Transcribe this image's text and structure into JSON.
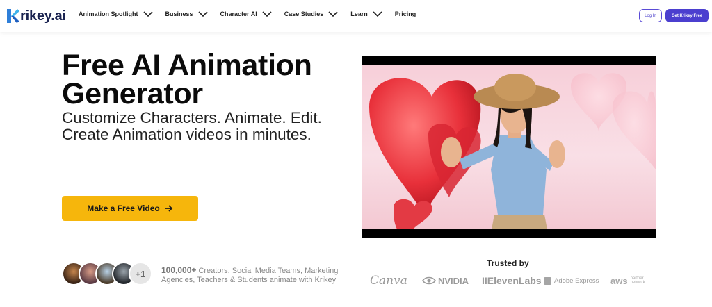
{
  "brand": {
    "logo_text": "rikey.ai",
    "logo_letter": "K"
  },
  "nav": {
    "items": [
      {
        "label": "Animation Spotlight",
        "has_dropdown": true
      },
      {
        "label": "Business",
        "has_dropdown": true
      },
      {
        "label": "Character AI",
        "has_dropdown": true
      },
      {
        "label": "Case Studies",
        "has_dropdown": true
      },
      {
        "label": "Learn",
        "has_dropdown": true
      },
      {
        "label": "Pricing",
        "has_dropdown": false
      }
    ],
    "login_label": "Log In",
    "get_free_label": "Get Krikey Free"
  },
  "hero": {
    "title_line1": "Free AI Animation",
    "title_line2": "Generator",
    "subtitle_line1": "Customize Characters. Animate. Edit.",
    "subtitle_line2": "Create Animation videos in minutes.",
    "cta_label": "Make a Free Video"
  },
  "social_proof": {
    "count": "100,000+",
    "text": " Creators, Social Media Teams, Marketing Agencies, Teachers & Students animate with Krikey",
    "more_avatars": "+1"
  },
  "trusted": {
    "label": "Trusted by",
    "brands": [
      "Canva",
      "NVIDIA",
      "IIElevenLabs",
      "Adobe Express",
      "aws",
      "partner",
      "network"
    ]
  },
  "colors": {
    "accent": "#4b3fcf",
    "cta": "#f6b60c",
    "logo_blue": "#2f9be0",
    "text_dark": "#0b0b0b"
  }
}
